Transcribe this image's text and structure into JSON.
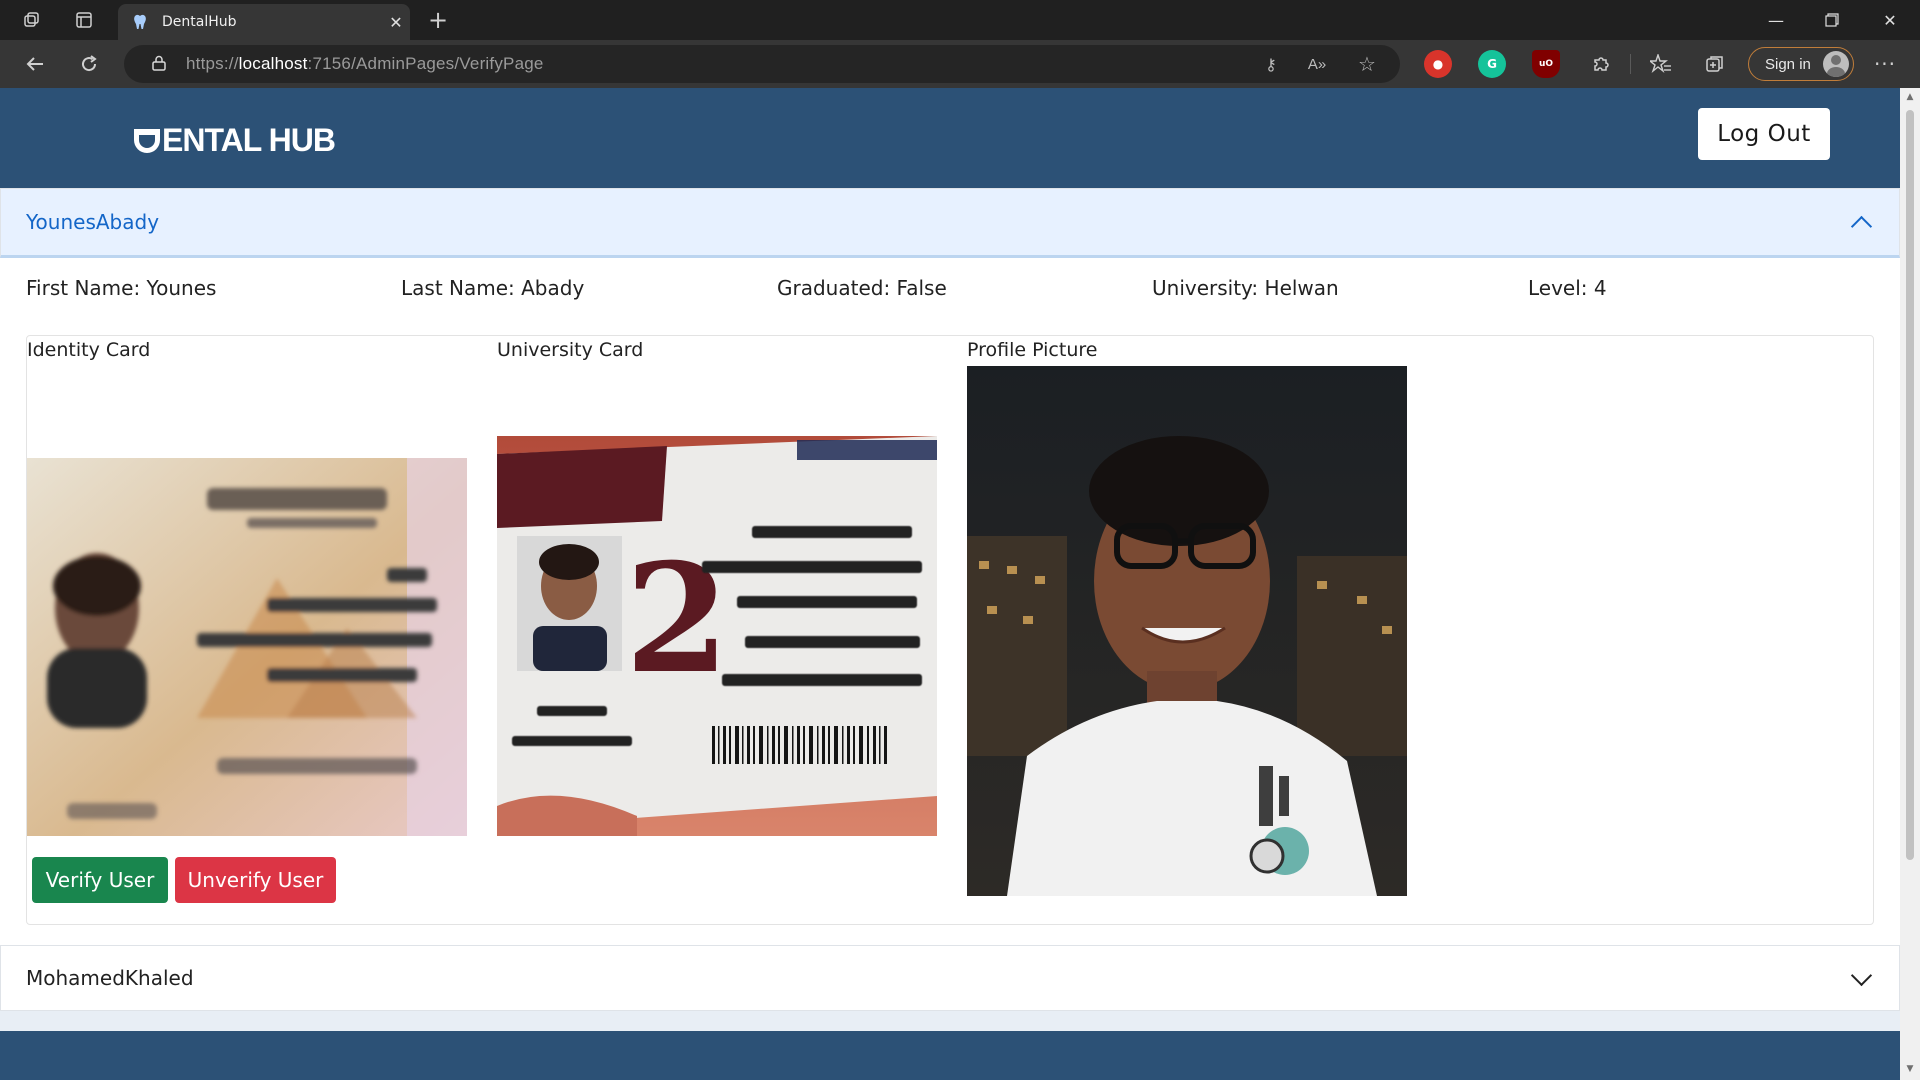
{
  "browser": {
    "tab_title": "DentalHub",
    "url_scheme": "https://",
    "url_host": "localhost",
    "url_rest": ":7156/AdminPages/VerifyPage",
    "sign_in_label": "Sign in",
    "icons": {
      "workspaces": "workspaces-icon",
      "tab_actions": "tab-actions-icon",
      "back": "back-arrow-icon",
      "refresh": "refresh-icon",
      "lock": "lock-icon",
      "favorites": "favorites-icon",
      "collections": "collections-icon",
      "more": "more-icon"
    }
  },
  "site": {
    "logo_text": "ENTAL HUB",
    "logout_label": "Log Out",
    "brand_color": "#2c5176"
  },
  "users": [
    {
      "username": "YounesAbady",
      "expanded": true,
      "first_name": "First Name: Younes",
      "last_name": "Last Name: Abady",
      "graduated": "Graduated: False",
      "university": "University: Helwan",
      "level": "Level: 4",
      "identity_card_label": "Identity Card",
      "university_card_label": "University Card",
      "profile_picture_label": "Profile Picture",
      "verify_label": "Verify User",
      "unverify_label": "Unverify User"
    },
    {
      "username": "MohamedKhaled",
      "expanded": false
    }
  ],
  "colors": {
    "verify": "#19864e",
    "unverify": "#dc3545",
    "accordion_active_text": "#1466c8",
    "accordion_active_bg": "#e7f1ff"
  }
}
